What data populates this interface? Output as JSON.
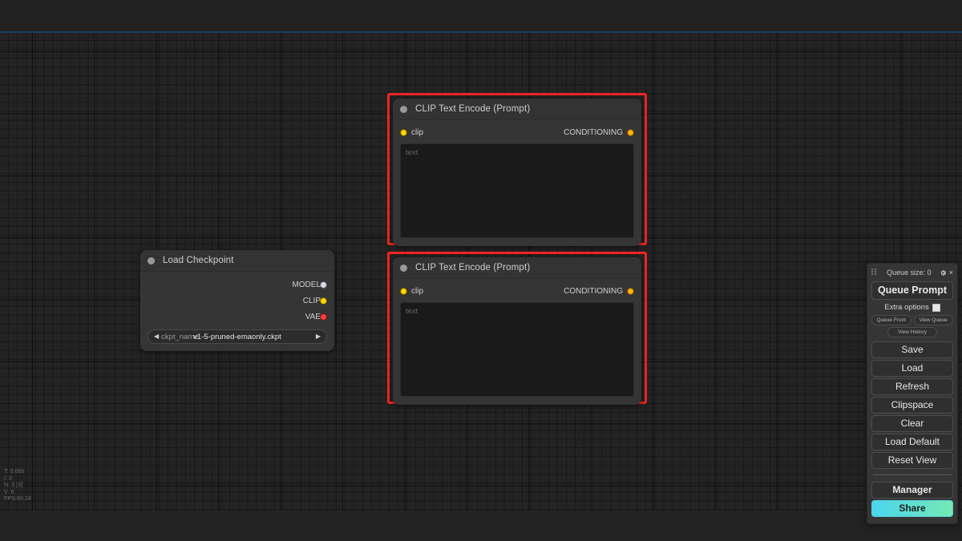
{
  "app": {
    "background_color": "#232323",
    "accent_red": "#f02424",
    "accent_cyan": "#4ad6ef"
  },
  "canvas": {
    "stats": {
      "time": "T: 0.00s",
      "iterations": "I: 0",
      "nodes": "N: 3 [3]",
      "vertices": "V: 6",
      "fps": "FPS:60.24"
    }
  },
  "nodes": {
    "load_checkpoint": {
      "title": "Load Checkpoint",
      "outputs": [
        {
          "label": "MODEL",
          "color": "#d9d9e8",
          "type": "model"
        },
        {
          "label": "CLIP",
          "color": "#FFD500",
          "type": "clip"
        },
        {
          "label": "VAE",
          "color": "#FF3C3C",
          "type": "vae"
        }
      ],
      "widget": {
        "name": "ckpt_name",
        "value": "v1-5-pruned-emaonly.ckpt",
        "left_arrow": "◀",
        "right_arrow": "▶"
      }
    },
    "clip_encode_positive": {
      "title": "CLIP Text Encode (Prompt)",
      "input": {
        "label": "clip",
        "color": "#FFD500"
      },
      "output": {
        "label": "CONDITIONING",
        "color": "#FFB000"
      },
      "text_value": "",
      "text_placeholder": "text",
      "selected": true
    },
    "clip_encode_negative": {
      "title": "CLIP Text Encode (Prompt)",
      "input": {
        "label": "clip",
        "color": "#FFD500"
      },
      "output": {
        "label": "CONDITIONING",
        "color": "#FFB000"
      },
      "text_value": "",
      "text_placeholder": "text",
      "selected": true
    }
  },
  "menu": {
    "queue_size_label": "Queue size: 0",
    "close_label": "×",
    "queue_prompt_label": "Queue Prompt",
    "extra_options_label": "Extra options",
    "queue_front_label": "Queue Front",
    "view_queue_label": "View Queue",
    "view_history_label": "View History",
    "save_label": "Save",
    "load_label": "Load",
    "refresh_label": "Refresh",
    "clipspace_label": "Clipspace",
    "clear_label": "Clear",
    "load_default_label": "Load Default",
    "reset_view_label": "Reset View",
    "manager_label": "Manager",
    "share_label": "Share"
  }
}
